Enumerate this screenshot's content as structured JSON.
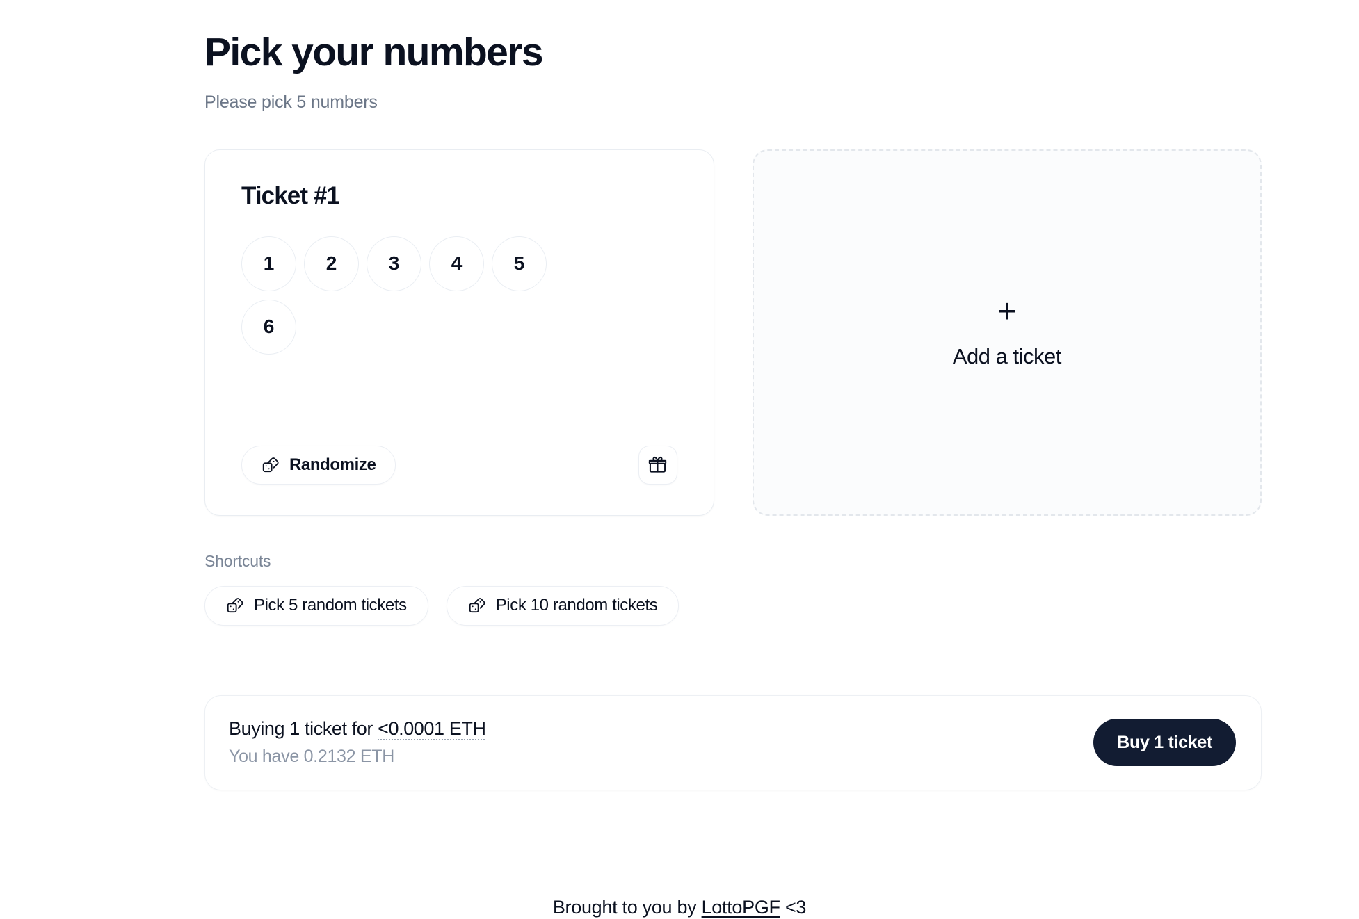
{
  "header": {
    "title": "Pick your numbers",
    "subtitle": "Please pick 5 numbers"
  },
  "ticket": {
    "title": "Ticket #1",
    "numbers": [
      "1",
      "2",
      "3",
      "4",
      "5",
      "6"
    ],
    "randomize_label": "Randomize",
    "randomize_icon": "dice-icon",
    "gift_icon": "gift-icon"
  },
  "add_ticket": {
    "plus": "+",
    "label": "Add a ticket",
    "plus_icon": "plus-icon"
  },
  "shortcuts": {
    "label": "Shortcuts",
    "items": [
      {
        "label": "Pick 5 random tickets",
        "icon": "dice-icon"
      },
      {
        "label": "Pick 10 random tickets",
        "icon": "dice-icon"
      }
    ]
  },
  "purchase": {
    "buying_prefix": "Buying 1 ticket for ",
    "price": "<0.0001 ETH",
    "balance": "You have 0.2132 ETH",
    "buy_label": "Buy 1 ticket"
  },
  "footer": {
    "prefix": "Brought to you by ",
    "link": "LottoPGF",
    "suffix": " <3"
  },
  "colors": {
    "text": "#0b1120",
    "muted": "#6b7687",
    "border": "#e9edf2",
    "accent": "#121c32"
  }
}
